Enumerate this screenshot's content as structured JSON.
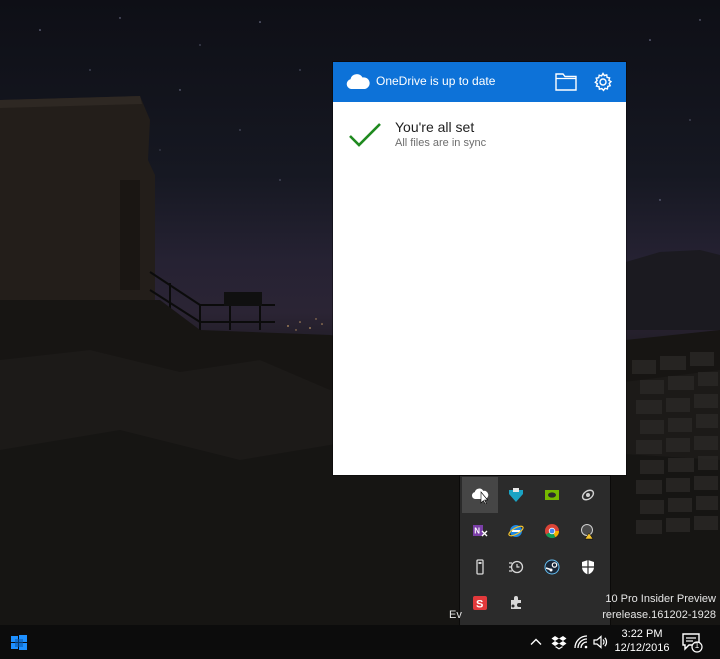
{
  "onedrive": {
    "header_title": "OneDrive is up to date",
    "status_title": "You're all set",
    "status_subtitle": "All files are in sync",
    "accent_color": "#0d72d8",
    "check_color": "#1f8a1f",
    "icons": [
      "onedrive-cloud-icon",
      "folder-icon",
      "gear-icon",
      "checkmark-icon"
    ]
  },
  "tray_overflow": {
    "icons": [
      "onedrive-icon",
      "tray-app-icon",
      "nvidia-icon",
      "satellite-icon",
      "onenote-icon",
      "ie-icon",
      "chrome-icon",
      "security-warning-icon",
      "usb-drive-icon",
      "time-icon",
      "steam-icon",
      "shield-icon",
      "snagit-icon",
      "puzzle-icon"
    ]
  },
  "watermark": {
    "line1": "10 Pro Insider Preview",
    "line2_left": "Ev",
    "line2": "rerelease.161202-1928"
  },
  "taskbar": {
    "time": "3:22 PM",
    "date": "12/12/2016",
    "notification_count": "1",
    "icons": [
      "start-icon",
      "chevron-up-icon",
      "dropbox-icon",
      "wifi-icon",
      "volume-icon",
      "action-center-icon"
    ]
  }
}
